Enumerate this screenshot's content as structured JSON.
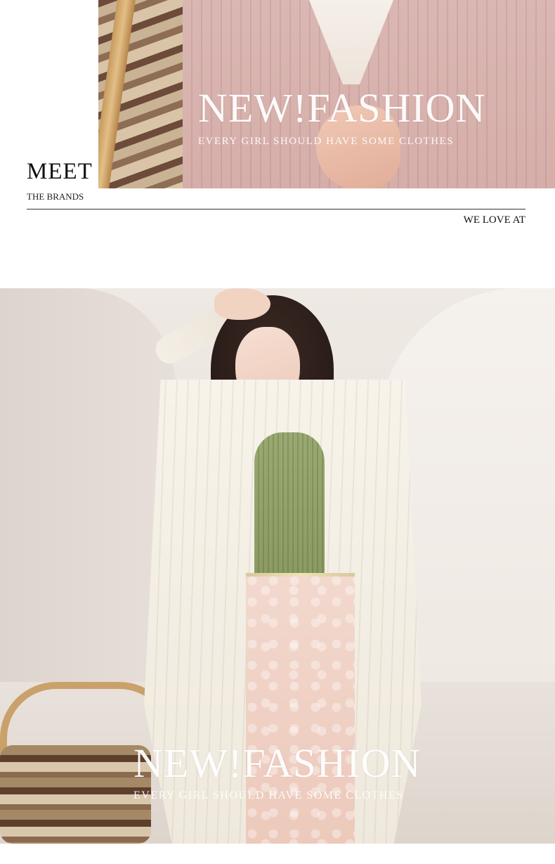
{
  "top_banner": {
    "title": "NEW!FASHION",
    "subtitle": "EVERY GIRL SHOULD HAVE SOME CLOTHES"
  },
  "brand_section": {
    "heading": "MEET",
    "subheading": "THE BRANDS",
    "right_text": "WE LOVE AT"
  },
  "main_banner": {
    "title": "NEW!FASHION",
    "subtitle": "EVERY GIRL SHOULD HAVE SOME CLOTHES"
  },
  "colors": {
    "text_dark": "#111111",
    "overlay_text": "#ffffff",
    "pink_knit": "#d7aea9",
    "green_top": "#8f9e66",
    "skirt_pink": "#efcfc2"
  }
}
